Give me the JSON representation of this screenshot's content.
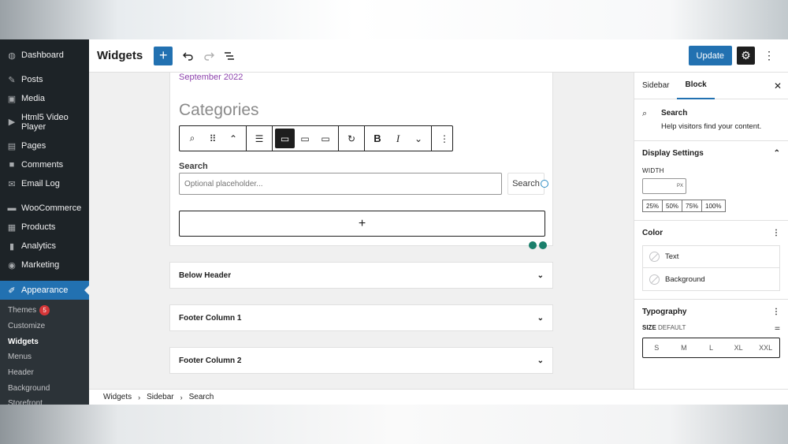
{
  "admin_menu": {
    "items": [
      {
        "label": "Dashboard",
        "icon": "dashboard-icon",
        "glyph": "◍"
      },
      {
        "label": "Posts",
        "icon": "pin-icon",
        "glyph": "✎"
      },
      {
        "label": "Media",
        "icon": "media-icon",
        "glyph": "▣"
      },
      {
        "label": "Html5 Video Player",
        "icon": "play-icon",
        "glyph": "▶"
      },
      {
        "label": "Pages",
        "icon": "pages-icon",
        "glyph": "▤"
      },
      {
        "label": "Comments",
        "icon": "comment-icon",
        "glyph": "■"
      },
      {
        "label": "Email Log",
        "icon": "email-icon",
        "glyph": "✉"
      },
      {
        "label": "WooCommerce",
        "icon": "woo-icon",
        "glyph": "▬"
      },
      {
        "label": "Products",
        "icon": "products-icon",
        "glyph": "▦"
      },
      {
        "label": "Analytics",
        "icon": "analytics-icon",
        "glyph": "▮"
      },
      {
        "label": "Marketing",
        "icon": "marketing-icon",
        "glyph": "◉"
      },
      {
        "label": "Appearance",
        "icon": "paintbrush-icon",
        "glyph": "✐"
      }
    ],
    "submenu": {
      "themes": "Themes",
      "themes_badge": "5",
      "customize": "Customize",
      "widgets": "Widgets",
      "menus": "Menus",
      "header": "Header",
      "background": "Background",
      "storefront": "Storefront"
    }
  },
  "topbar": {
    "title": "Widgets",
    "add_glyph": "+",
    "update_label": "Update"
  },
  "canvas": {
    "date_link": "September 2022",
    "categories_title": "Categories",
    "search_label": "Search",
    "search_placeholder": "Optional placeholder...",
    "search_button": "Search",
    "appender_glyph": "+",
    "areas": [
      "Below Header",
      "Footer Column 1",
      "Footer Column 2"
    ]
  },
  "breadcrumb": [
    "Widgets",
    "Sidebar",
    "Search"
  ],
  "panel": {
    "tabs": [
      "Sidebar",
      "Block"
    ],
    "block_name": "Search",
    "block_desc": "Help visitors find your content.",
    "display_settings": "Display Settings",
    "width_label": "WIDTH",
    "width_unit": "PX",
    "percent_options": [
      "25%",
      "50%",
      "75%",
      "100%"
    ],
    "color_title": "Color",
    "color_items": [
      "Text",
      "Background"
    ],
    "typography_title": "Typography",
    "size_label": "SIZE",
    "size_default": "DEFAULT",
    "size_options": [
      "S",
      "M",
      "L",
      "XL",
      "XXL"
    ]
  },
  "colors": {
    "accent": "#2271b1",
    "admin_bg": "#1d2327",
    "link_purple": "#8e44ad"
  }
}
